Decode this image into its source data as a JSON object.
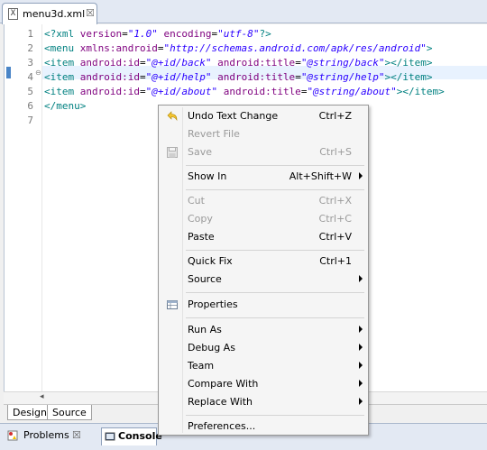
{
  "editor_tab": {
    "title": "menu3d.xml",
    "close_glyph": "☒"
  },
  "code_lines": [
    {
      "n": "1"
    },
    {
      "n": "2"
    },
    {
      "n": "3"
    },
    {
      "n": "4"
    },
    {
      "n": "5"
    },
    {
      "n": "6"
    },
    {
      "n": "7"
    }
  ],
  "code": {
    "l1_a": "<?xml ",
    "l1_b": "version",
    "l1_c": "=",
    "l1_d": "\"1.0\"",
    "l1_e": " encoding",
    "l1_f": "=",
    "l1_g": "\"utf-8\"",
    "l1_h": "?>",
    "l2_a": "<menu ",
    "l2_b": "xmlns:android",
    "l2_c": "=",
    "l2_d": "\"http://schemas.android.com/apk/res/android\"",
    "l2_e": ">",
    "l3_a": "<item ",
    "l3_b": "android:id",
    "l3_c": "=",
    "l3_d": "\"@+id/back\"",
    "l3_e": " android:title",
    "l3_f": "=",
    "l3_g": "\"@string/back\"",
    "l3_h": "></item>",
    "l4_a": "<item ",
    "l4_b": "android:id",
    "l4_c": "=",
    "l4_d": "\"@+id/help\"",
    "l4_e": " android:title",
    "l4_f": "=",
    "l4_g": "\"@string/help\"",
    "l4_h": "></item>",
    "l5_a": "<item ",
    "l5_b": "android:id",
    "l5_c": "=",
    "l5_d": "\"@+id/about\"",
    "l5_e": " android:title",
    "l5_f": "=",
    "l5_g": "\"@string/about\"",
    "l5_h": "></item>",
    "l6": "</menu>"
  },
  "bottom_tabs": {
    "design": "Design",
    "source": "Source"
  },
  "views": {
    "problems": "Problems",
    "console": "Console"
  },
  "context_menu": {
    "undo": {
      "label": "Undo Text Change",
      "shortcut": "Ctrl+Z"
    },
    "revert": {
      "label": "Revert File"
    },
    "save": {
      "label": "Save",
      "shortcut": "Ctrl+S"
    },
    "show_in": {
      "label": "Show In",
      "shortcut": "Alt+Shift+W"
    },
    "cut": {
      "label": "Cut",
      "shortcut": "Ctrl+X"
    },
    "copy": {
      "label": "Copy",
      "shortcut": "Ctrl+C"
    },
    "paste": {
      "label": "Paste",
      "shortcut": "Ctrl+V"
    },
    "quick_fix": {
      "label": "Quick Fix",
      "shortcut": "Ctrl+1"
    },
    "source": {
      "label": "Source"
    },
    "properties": {
      "label": "Properties"
    },
    "run_as": {
      "label": "Run As"
    },
    "debug_as": {
      "label": "Debug As"
    },
    "team": {
      "label": "Team"
    },
    "compare_with": {
      "label": "Compare With"
    },
    "replace_with": {
      "label": "Replace With"
    },
    "preferences": {
      "label": "Preferences..."
    }
  },
  "icons": {
    "file": "xml-file-icon",
    "undo": "undo-arrow-icon",
    "save": "save-disk-icon",
    "properties": "properties-table-icon",
    "problems": "problems-icon",
    "console": "console-icon"
  },
  "colors": {
    "xml_tag": "#008080",
    "xml_attr": "#7f007f",
    "xml_value": "#2a00ff",
    "current_line": "#e8f2fe",
    "disabled_text": "#9a9a9a"
  }
}
